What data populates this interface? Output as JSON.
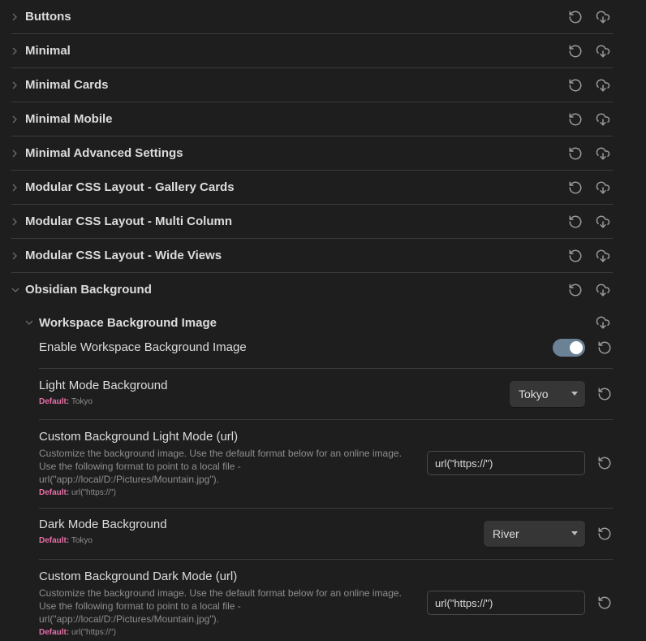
{
  "sections": [
    {
      "title": "Buttons"
    },
    {
      "title": "Minimal"
    },
    {
      "title": "Minimal Cards"
    },
    {
      "title": "Minimal Mobile"
    },
    {
      "title": "Minimal Advanced Settings"
    },
    {
      "title": "Modular CSS Layout - Gallery Cards"
    },
    {
      "title": "Modular CSS Layout - Multi Column"
    },
    {
      "title": "Modular CSS Layout - Wide Views"
    },
    {
      "title": "Obsidian Background"
    }
  ],
  "subsection": {
    "title": "Workspace Background Image"
  },
  "settings": {
    "enable": {
      "name": "Enable Workspace Background Image",
      "enabled": true
    },
    "light": {
      "name": "Light Mode Background",
      "default_label": "Default:",
      "default_value": "Tokyo",
      "selected": "Tokyo"
    },
    "custom_light": {
      "name": "Custom Background Light Mode (url)",
      "desc": "Customize the background image. Use the default format below for an online image. Use the following format to point to a local file - url(\"app://local/D:/Pictures/Mountain.jpg\").",
      "default_label": "Default:",
      "default_value": "url(\"https://\")",
      "value": "url(\"https://\")"
    },
    "dark": {
      "name": "Dark Mode Background",
      "default_label": "Default:",
      "default_value": "Tokyo",
      "selected": "River"
    },
    "custom_dark": {
      "name": "Custom Background Dark Mode (url)",
      "desc": "Customize the background image. Use the default format below for an online image. Use the following format to point to a local file - url(\"app://local/D:/Pictures/Mountain.jpg\").",
      "default_label": "Default:",
      "default_value": "url(\"https://\")",
      "value": "url(\"https://\")"
    }
  },
  "icons": {
    "reset": "reset-icon",
    "import": "cloud-download-icon",
    "chevron_right": "chevron-right-icon",
    "chevron_down": "chevron-down-icon"
  },
  "colors": {
    "background": "#1e1e1e",
    "accent_default": "#e36fa6",
    "toggle_on": "#6b8196"
  }
}
